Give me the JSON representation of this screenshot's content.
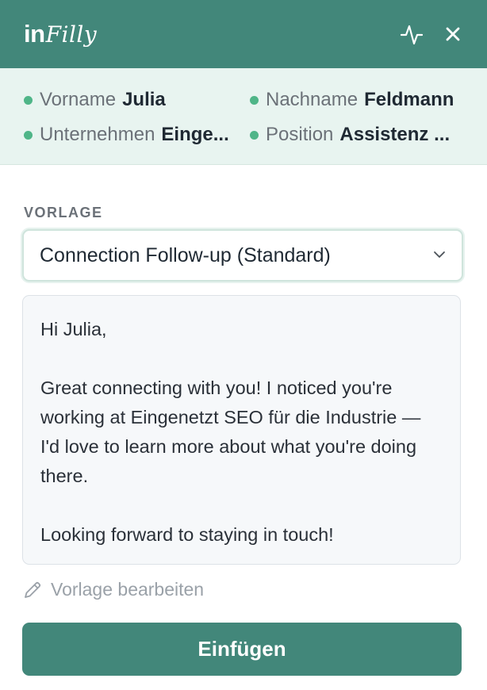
{
  "header": {
    "logo_prefix": "in",
    "logo_suffix": "Filly",
    "activity_icon": "activity-icon",
    "close_icon": "close-icon",
    "color": "#42877a"
  },
  "contact": {
    "fields": [
      {
        "label": "Vorname",
        "value": "Julia"
      },
      {
        "label": "Nachname",
        "value": "Feldmann"
      },
      {
        "label": "Unternehmen",
        "value": "Einge..."
      },
      {
        "label": "Position",
        "value": "Assistenz ..."
      }
    ],
    "dot_color": "#4fb588",
    "background": "#e8f4f0"
  },
  "template": {
    "section_label": "VORLAGE",
    "selected": "Connection Follow-up (Standard)",
    "message": "Hi Julia,\n\nGreat connecting with you! I noticed you're working at Eingenetzt SEO für die Industrie — I'd love to learn more about what you're doing there.\n\nLooking forward to staying in touch!",
    "edit_label": "Vorlage bearbeiten"
  },
  "actions": {
    "insert_label": "Einfügen"
  }
}
